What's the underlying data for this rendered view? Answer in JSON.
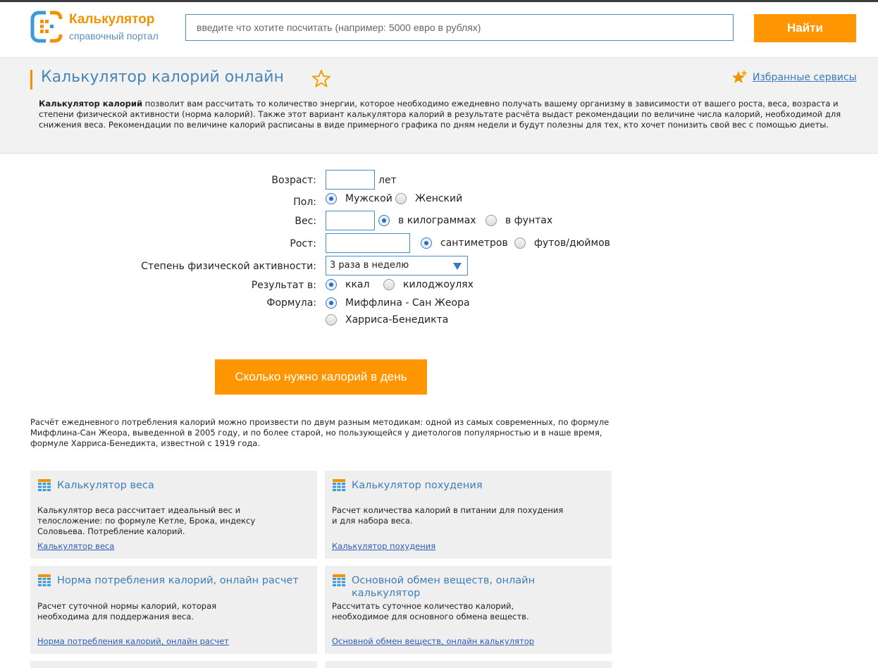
{
  "header": {
    "logo_title": "Калькулятор",
    "logo_subtitle": "справочный портал",
    "search_placeholder": "введите что хотите посчитать (например: 5000 евро в рублях)",
    "search_button": "Найти"
  },
  "intro": {
    "title": "Калькулятор калорий онлайн",
    "favorites_link": "Избранные сервисы",
    "text_bold": "Калькулятор калорий",
    "text_rest": " позволит вам рассчитать то количество энергии, которое необходимо ежедневно получать вашему организму в зависимости от вашего роста, веса, возраста и степени физической активности (норма калорий). Также этот вариант калькулятора калорий в результате расчёта выдаст рекомендации по величине числа калорий, необходимой для снижения веса. Рекомендации по величине калорий расписаны в виде примерного графика по дням недели и будут полезны для тех, кто хочет понизить свой вес с помощью диеты."
  },
  "form": {
    "age_label": "Возраст:",
    "age_unit": "лет",
    "age_value": "",
    "gender_label": "Пол:",
    "gender_male": "Мужской",
    "gender_female": "Женский",
    "weight_label": "Вес:",
    "weight_value": "",
    "weight_kg": "в килограммах",
    "weight_lb": "в фунтах",
    "height_label": "Рост:",
    "height_value": "",
    "height_cm": "сантиметров",
    "height_ft": "футов/дюймов",
    "activity_label": "Степень физической активности:",
    "activity_selected": "3 раза в неделю",
    "result_label": "Результат в:",
    "result_kcal": "ккал",
    "result_kj": "килоджоулях",
    "formula_label": "Формула:",
    "formula_mifflin": "Миффлина - Сан Жеора",
    "formula_harris": "Харриса-Бенедикта",
    "submit_button": "Сколько нужно калорий в день"
  },
  "description": "Расчёт ежедневного потребления калорий можно произвести по двум разным методикам: одной из самых современных, по формуле Миффлина-Сан Жеора, выведенной в 2005 году, и по более старой, но пользующейся у диетологов популярностью и в наше время, формуле Харриса-Бенедикта, известной с 1919 года.",
  "cards": [
    {
      "title": "Калькулятор веса",
      "text": "Калькулятор веса рассчитает идеальный вес и телосложение: по формуле Кетле, Брока, индексу Соловьева. Потребление калорий.",
      "link": "Калькулятор веса"
    },
    {
      "title": "Калькулятор похудения",
      "text": "Расчет количества калорий в питании для похудения и для набора веса.",
      "link": "Калькулятор похудения"
    },
    {
      "title": "Норма потребления калорий, онлайн расчет",
      "text": "Расчет суточной нормы калорий, которая необходима для поддержания веса.",
      "link": "Норма потребления калорий, онлайн расчет"
    },
    {
      "title": "Основной обмен веществ, онлайн калькулятор",
      "text": "Рассчитать суточное количество калорий, необходимое для основного обмена веществ.",
      "link": "Основной обмен веществ, онлайн калькулятор"
    }
  ],
  "colors": {
    "accent_orange": "#ff9500",
    "link_blue": "#3e7db5",
    "card_bg": "#efefef",
    "intro_bg": "#f2f2f2"
  }
}
